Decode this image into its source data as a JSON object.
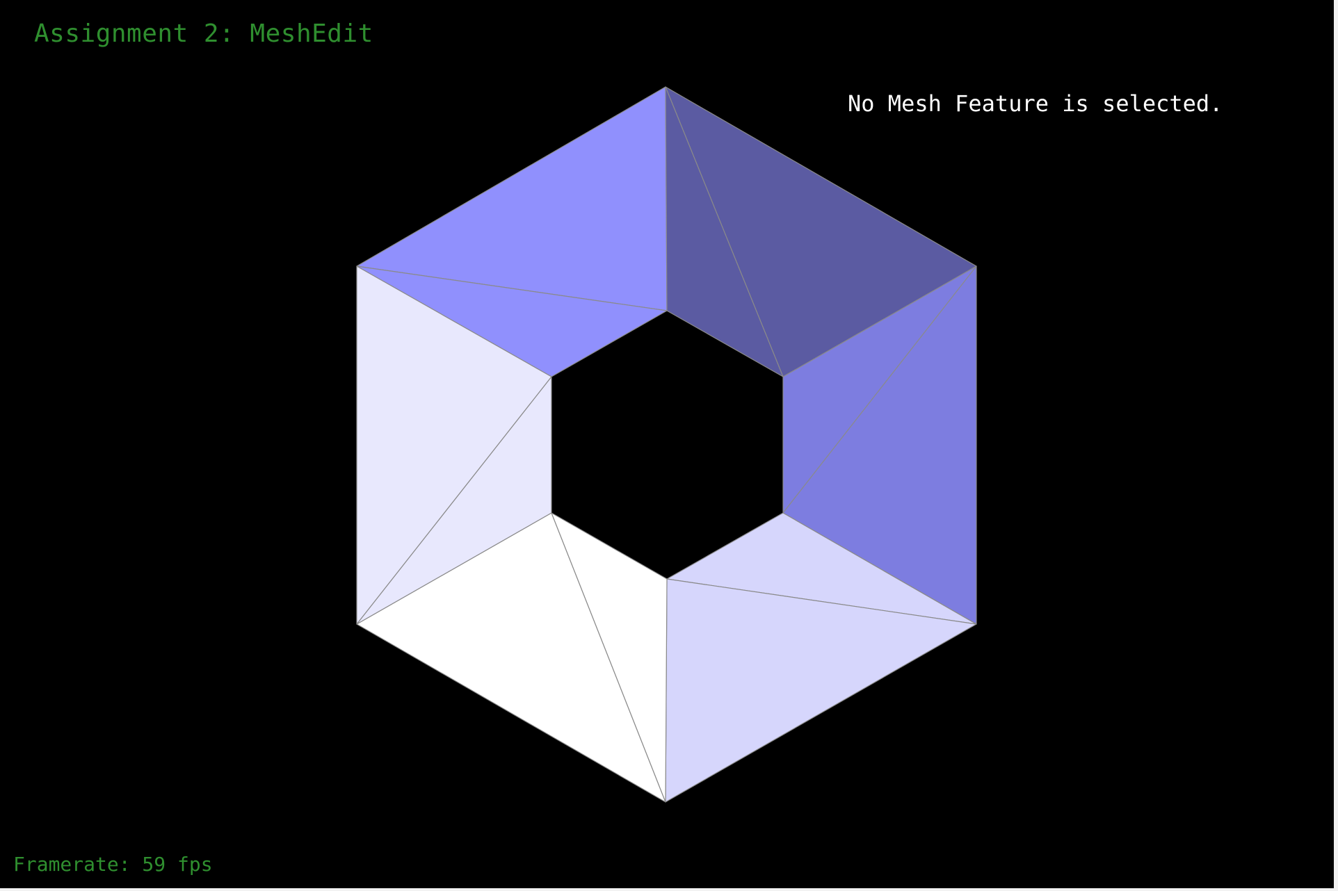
{
  "app": {
    "title": "Assignment 2: MeshEdit",
    "selection_status": "No Mesh Feature is selected.",
    "framerate_text": "Framerate: 59 fps"
  },
  "colors": {
    "background": "#000000",
    "hud_text": "#2f8f2f",
    "status_text": "#ffffff",
    "edge": "#8a8a8a"
  },
  "mesh": {
    "description_name": "hexagonal ring mesh",
    "faces": [
      {
        "name": "top-left-outer",
        "shade": "#9090fd"
      },
      {
        "name": "top-left-inner",
        "shade": "#9090fd"
      },
      {
        "name": "top-right-outer",
        "shade": "#5b5ba2"
      },
      {
        "name": "top-right-inner",
        "shade": "#5b5ba2"
      },
      {
        "name": "right-upper",
        "shade": "#7d7de0"
      },
      {
        "name": "right-lower",
        "shade": "#7d7de0"
      },
      {
        "name": "bottom-right-inner",
        "shade": "#d6d6fc"
      },
      {
        "name": "bottom-right-outer",
        "shade": "#d6d6fc"
      },
      {
        "name": "bottom-left-outer",
        "shade": "#ffffff"
      },
      {
        "name": "bottom-left-inner",
        "shade": "#ffffff"
      },
      {
        "name": "left-lower",
        "shade": "#e8e8fd"
      },
      {
        "name": "left-upper",
        "shade": "#e8e8fd"
      }
    ]
  }
}
